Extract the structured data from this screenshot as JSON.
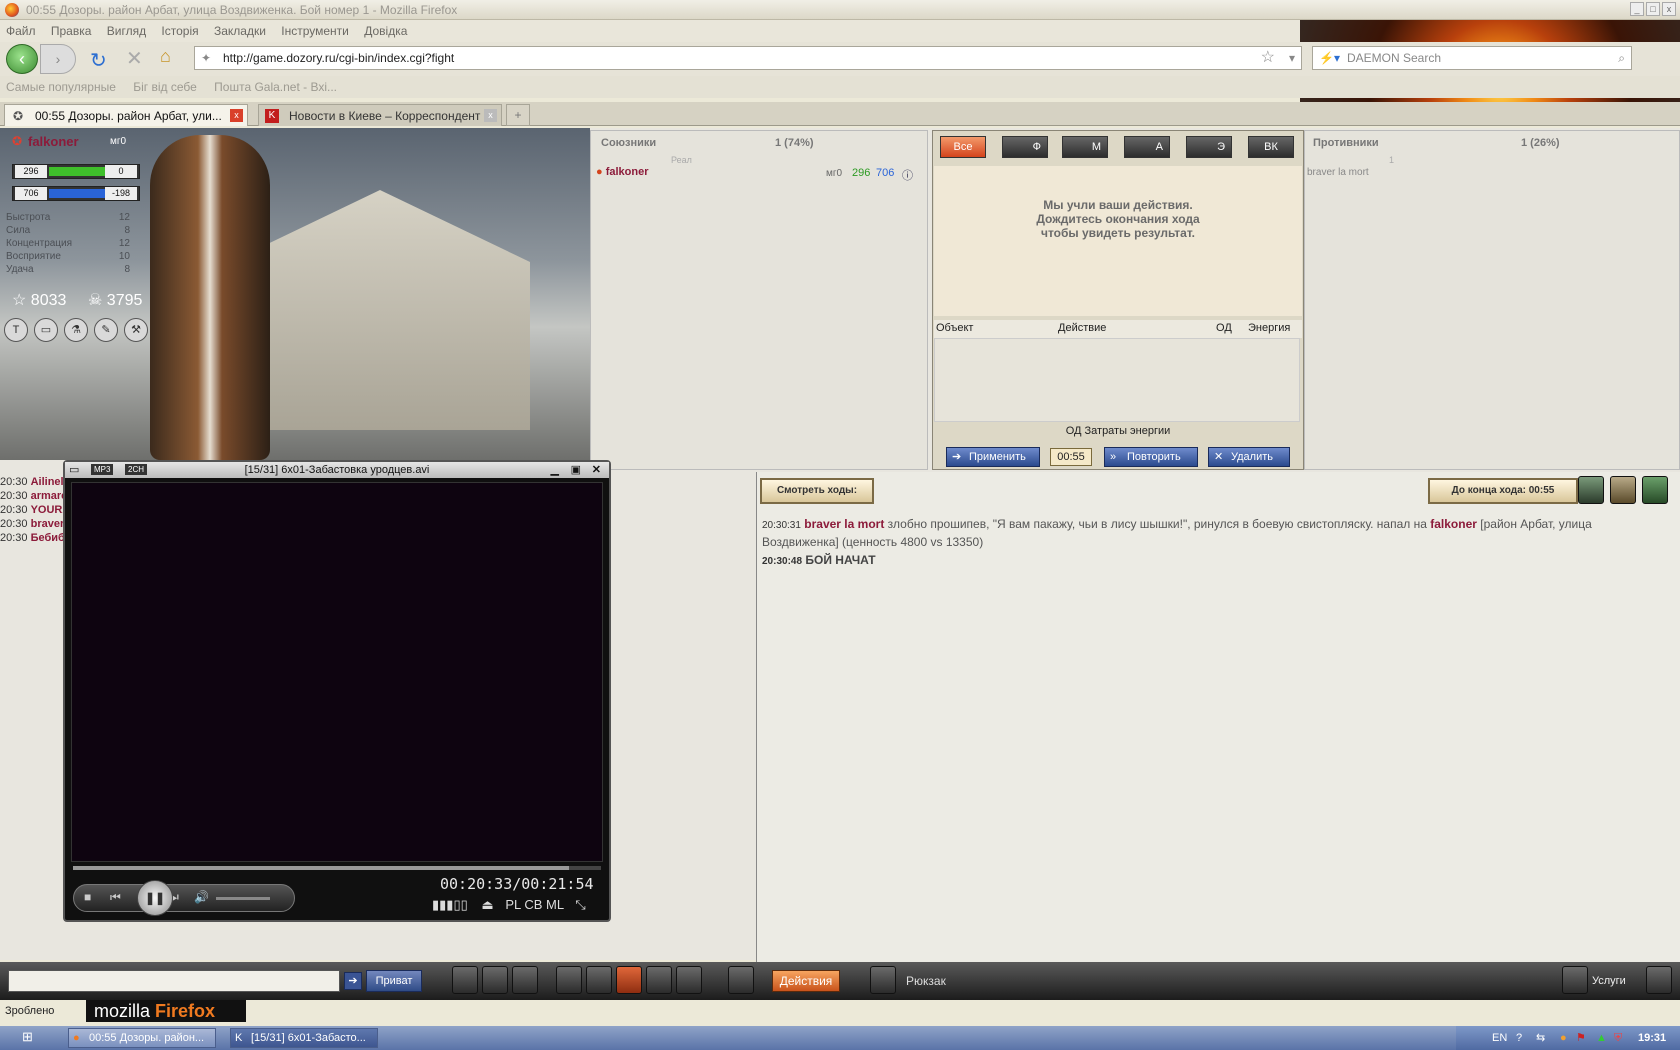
{
  "window": {
    "title": "00:55 Дозоры. район Арбат, улица Воздвиженка. Бой номер 1 - Mozilla Firefox"
  },
  "menu": [
    "Файл",
    "Правка",
    "Вигляд",
    "Історія",
    "Закладки",
    "Інструменти",
    "Довідка"
  ],
  "nav": {
    "url": "http://game.dozory.ru/cgi-bin/index.cgi?fight",
    "search_placeholder": "DAEMON Search"
  },
  "bookmarks": [
    "Самые популярные",
    "Біг від себе",
    "Пошта Gala.net - Вхі..."
  ],
  "tabs": [
    {
      "label": "00:55 Дозоры. район Арбат, ули..."
    },
    {
      "label": "Новости в Киеве – Корреспондент"
    }
  ],
  "character": {
    "name": "falkoner",
    "level": "мг0",
    "hp": "296",
    "hp_right": "0",
    "energy": "706",
    "energy_right": "-198",
    "attrs": [
      {
        "name": "Быстрота",
        "val": "12"
      },
      {
        "name": "Сила",
        "val": "8"
      },
      {
        "name": "Концентрация",
        "val": "12"
      },
      {
        "name": "Восприятие",
        "val": "10"
      },
      {
        "name": "Удача",
        "val": "8"
      }
    ],
    "glory": "8033",
    "skulls": "3795"
  },
  "allies": {
    "title": "Союзники",
    "count": "1 (74%)",
    "sublabel": "Реал",
    "row": {
      "name": "falkoner",
      "level": "мг0",
      "hp": "296",
      "energy": "706"
    }
  },
  "enemies": {
    "title": "Противники",
    "count": "1 (26%)",
    "sublabel": "1",
    "row": {
      "name": "braver la mort"
    }
  },
  "filters": [
    "Все",
    "Ф",
    "М",
    "А",
    "Э",
    "ВК"
  ],
  "wait_message": [
    "Мы учли ваши действия.",
    "Дождитесь окончания хода",
    "чтобы увидеть результат."
  ],
  "action_table": {
    "headers": [
      "Объект",
      "Действие",
      "ОД",
      "Энергия"
    ]
  },
  "costs": "ОД   Затраты энергии",
  "actions": {
    "apply": "Применить",
    "timer": "00:55",
    "repeat": "Повторить",
    "delete": "Удалить"
  },
  "view_moves": "Смотреть ходы:",
  "turn_end": "До конца хода: 00:55",
  "chat": [
    {
      "time": "20:30",
      "name": "Ailinel"
    },
    {
      "time": "20:30",
      "name": "armare"
    },
    {
      "time": "20:30",
      "name": "YOURA"
    },
    {
      "time": "20:30",
      "name": "braver"
    },
    {
      "time": "20:30",
      "name": "Бебиб"
    }
  ],
  "log": [
    {
      "time": "20:30:31",
      "actor": "braver la mort",
      "text1": " злобно прошипев, \"Я вам пакажу, чьи в лису шышки!\", ринулся в боевую свистопляску. напал на ",
      "target": "falkoner",
      "text2": " [район Арбат, улица Воздвиженка] (ценность 4800 vs 13350)"
    },
    {
      "time": "20:30:48",
      "text": "БОЙ НАЧАТ"
    }
  ],
  "player": {
    "badge1": "MP3",
    "badge2": "2CH",
    "title": "[15/31] 6x01-Забастовка уродцев.avi",
    "time": "00:20:33/00:21:54",
    "buttons": "PL  CB  ML",
    "progress_fraction": 0.939
  },
  "bottom": {
    "privat": "Приват",
    "actions": "Действия",
    "backpack": "Рюкзак",
    "services": "Услуги"
  },
  "status": {
    "text": "Зроблено",
    "brand_a": "mozilla ",
    "brand_b": "Firefox"
  },
  "taskbar": {
    "items": [
      "00:55 Дозоры. район...",
      "[15/31] 6x01-Забасто..."
    ],
    "lang": "EN",
    "clock": "19:31"
  },
  "colors": {
    "accent_orange": "#d4441c",
    "name_red": "#8c1b3a",
    "hp_green": "#3fbf2b",
    "energy_blue": "#2a64d8"
  }
}
